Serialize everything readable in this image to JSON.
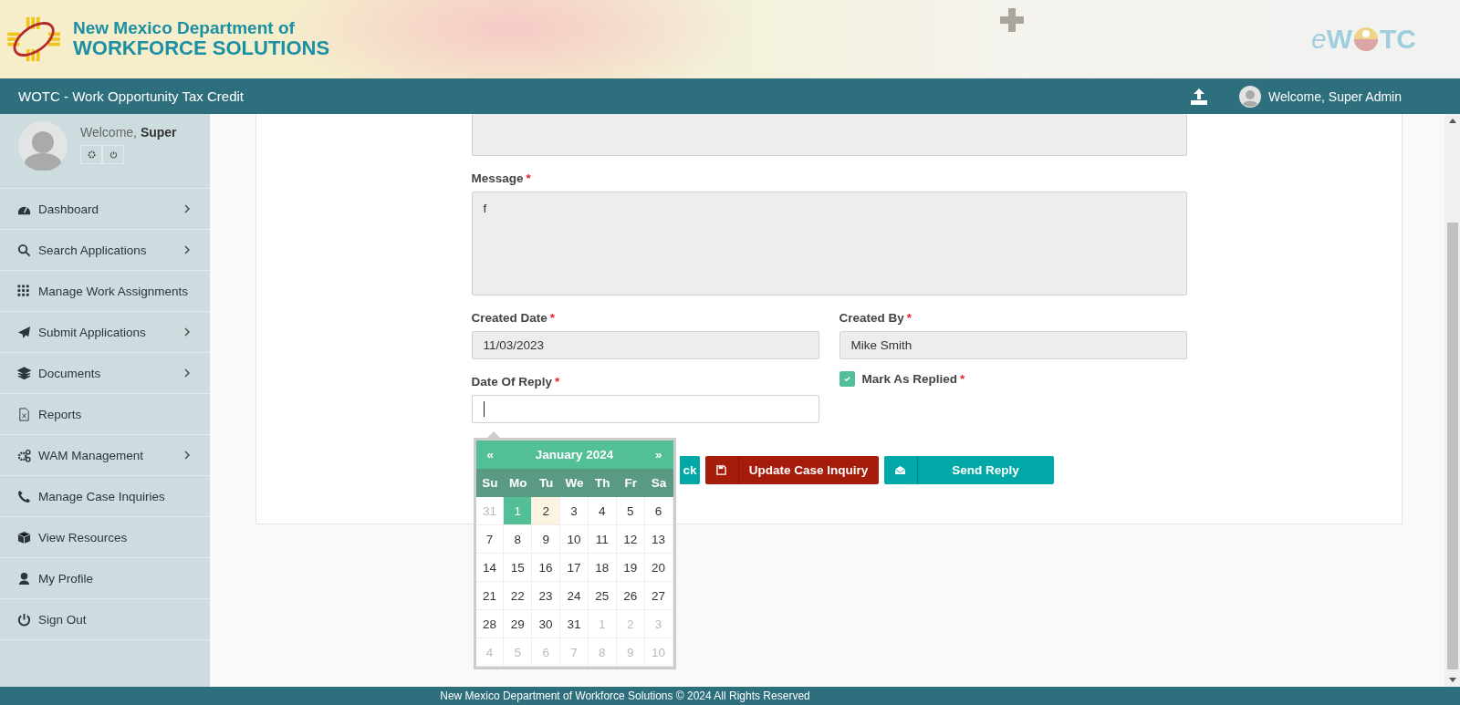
{
  "header": {
    "org_line1": "New Mexico Department of",
    "org_line2": "WORKFORCE SOLUTIONS",
    "app_logo": [
      "e",
      "W",
      "TC"
    ]
  },
  "navbar": {
    "title": "WOTC - Work Opportunity Tax Credit",
    "user": "Welcome, Super Admin"
  },
  "sidebar": {
    "welcome": "Welcome,",
    "user": "Super",
    "items": [
      {
        "label": "Dashboard",
        "kind": "dashboard",
        "expandable": true
      },
      {
        "label": "Search Applications",
        "kind": "search",
        "expandable": true
      },
      {
        "label": "Manage Work Assignments",
        "kind": "assignments",
        "expandable": false
      },
      {
        "label": "Submit Applications",
        "kind": "submit",
        "expandable": true
      },
      {
        "label": "Documents",
        "kind": "documents",
        "expandable": true
      },
      {
        "label": "Reports",
        "kind": "reports",
        "expandable": false
      },
      {
        "label": "WAM Management",
        "kind": "management",
        "expandable": true
      },
      {
        "label": "Manage Case Inquiries",
        "kind": "inquiries",
        "expandable": false
      },
      {
        "label": "View Resources",
        "kind": "resources",
        "expandable": false
      },
      {
        "label": "My Profile",
        "kind": "profile",
        "expandable": false
      },
      {
        "label": "Sign Out",
        "kind": "signout",
        "expandable": false
      }
    ]
  },
  "form": {
    "message": {
      "label": "Message",
      "required_mark": "*",
      "value": "f"
    },
    "created_date": {
      "label": "Created Date",
      "required_mark": "*",
      "value": "11/03/2023"
    },
    "created_by": {
      "label": "Created By",
      "required_mark": "*",
      "value": "Mike Smith"
    },
    "date_of_reply": {
      "label": "Date Of Reply",
      "required_mark": "*",
      "focused": true
    },
    "mark_as_replied": {
      "label": "Mark As Replied",
      "required_mark": "*",
      "checked": true
    }
  },
  "buttons": [
    {
      "label": "ck",
      "kind": "back"
    },
    {
      "label": "Update Case Inquiry",
      "kind": "update"
    },
    {
      "label": "Send Reply",
      "kind": "send"
    }
  ],
  "datepicker": {
    "prev": "«",
    "title": "January 2024",
    "next": "»",
    "weekdays": [
      "Su",
      "Mo",
      "Tu",
      "We",
      "Th",
      "Fr",
      "Sa"
    ],
    "weeks": [
      [
        {
          "day": "31",
          "other_month": true,
          "selected": false,
          "today": false
        },
        {
          "day": "1",
          "other_month": false,
          "selected": true,
          "today": false
        },
        {
          "day": "2",
          "other_month": false,
          "selected": false,
          "today": true
        },
        {
          "day": "3",
          "other_month": false,
          "selected": false,
          "today": false
        },
        {
          "day": "4",
          "other_month": false,
          "selected": false,
          "today": false
        },
        {
          "day": "5",
          "other_month": false,
          "selected": false,
          "today": false
        },
        {
          "day": "6",
          "other_month": false,
          "selected": false,
          "today": false
        }
      ],
      [
        {
          "day": "7",
          "other_month": false,
          "selected": false,
          "today": false
        },
        {
          "day": "8",
          "other_month": false,
          "selected": false,
          "today": false
        },
        {
          "day": "9",
          "other_month": false,
          "selected": false,
          "today": false
        },
        {
          "day": "10",
          "other_month": false,
          "selected": false,
          "today": false
        },
        {
          "day": "11",
          "other_month": false,
          "selected": false,
          "today": false
        },
        {
          "day": "12",
          "other_month": false,
          "selected": false,
          "today": false
        },
        {
          "day": "13",
          "other_month": false,
          "selected": false,
          "today": false
        }
      ],
      [
        {
          "day": "14",
          "other_month": false,
          "selected": false,
          "today": false
        },
        {
          "day": "15",
          "other_month": false,
          "selected": false,
          "today": false
        },
        {
          "day": "16",
          "other_month": false,
          "selected": false,
          "today": false
        },
        {
          "day": "17",
          "other_month": false,
          "selected": false,
          "today": false
        },
        {
          "day": "18",
          "other_month": false,
          "selected": false,
          "today": false
        },
        {
          "day": "19",
          "other_month": false,
          "selected": false,
          "today": false
        },
        {
          "day": "20",
          "other_month": false,
          "selected": false,
          "today": false
        }
      ],
      [
        {
          "day": "21",
          "other_month": false,
          "selected": false,
          "today": false
        },
        {
          "day": "22",
          "other_month": false,
          "selected": false,
          "today": false
        },
        {
          "day": "23",
          "other_month": false,
          "selected": false,
          "today": false
        },
        {
          "day": "24",
          "other_month": false,
          "selected": false,
          "today": false
        },
        {
          "day": "25",
          "other_month": false,
          "selected": false,
          "today": false
        },
        {
          "day": "26",
          "other_month": false,
          "selected": false,
          "today": false
        },
        {
          "day": "27",
          "other_month": false,
          "selected": false,
          "today": false
        }
      ],
      [
        {
          "day": "28",
          "other_month": false,
          "selected": false,
          "today": false
        },
        {
          "day": "29",
          "other_month": false,
          "selected": false,
          "today": false
        },
        {
          "day": "30",
          "other_month": false,
          "selected": false,
          "today": false
        },
        {
          "day": "31",
          "other_month": false,
          "selected": false,
          "today": false
        },
        {
          "day": "1",
          "other_month": true,
          "selected": false,
          "today": false
        },
        {
          "day": "2",
          "other_month": true,
          "selected": false,
          "today": false
        },
        {
          "day": "3",
          "other_month": true,
          "selected": false,
          "today": false
        }
      ],
      [
        {
          "day": "4",
          "other_month": true,
          "selected": false,
          "today": false
        },
        {
          "day": "5",
          "other_month": true,
          "selected": false,
          "today": false
        },
        {
          "day": "6",
          "other_month": true,
          "selected": false,
          "today": false
        },
        {
          "day": "7",
          "other_month": true,
          "selected": false,
          "today": false
        },
        {
          "day": "8",
          "other_month": true,
          "selected": false,
          "today": false
        },
        {
          "day": "9",
          "other_month": true,
          "selected": false,
          "today": false
        },
        {
          "day": "10",
          "other_month": true,
          "selected": false,
          "today": false
        }
      ]
    ]
  },
  "footer": "New Mexico Department of Workforce Solutions © 2024 All Rights Reserved"
}
